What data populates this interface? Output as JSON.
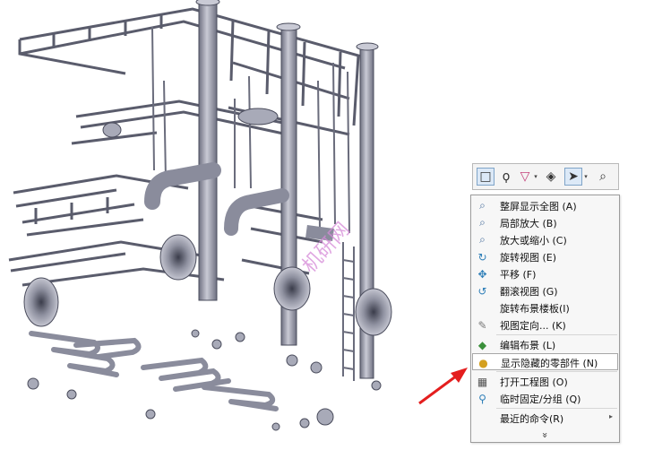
{
  "watermark": "机研网",
  "toolbar": {
    "icons": [
      "selection-box-icon",
      "lasso-icon",
      "filter-icon",
      "view-orientation-icon",
      "select-arrow-icon",
      "zoom-icon"
    ],
    "dropdown_glyph": "▾"
  },
  "context_menu": {
    "items": [
      {
        "label": "整屏显示全图 (A)",
        "icon": "zoom-to-fit-icon"
      },
      {
        "label": "局部放大 (B)",
        "icon": "zoom-to-area-icon"
      },
      {
        "label": "放大或缩小 (C)",
        "icon": "zoom-in-out-icon"
      },
      {
        "label": "旋转视图 (E)",
        "icon": "rotate-view-icon"
      },
      {
        "label": "平移 (F)",
        "icon": "pan-icon"
      },
      {
        "label": "翻滚视图 (G)",
        "icon": "roll-view-icon"
      },
      {
        "label": "旋转布景楼板(I)",
        "icon": ""
      },
      {
        "label": "视图定向... (K)",
        "icon": "view-orientation-icon"
      },
      {
        "label": "编辑布景 (L)",
        "icon": "edit-scene-icon"
      },
      {
        "label": "显示隐藏的零部件 (N)",
        "icon": "show-hidden-components-icon"
      },
      {
        "label": "打开工程图 (O)",
        "icon": "open-drawing-icon"
      },
      {
        "label": "临时固定/分组 (Q)",
        "icon": "temporary-fix-icon"
      },
      {
        "label": "最近的命令(R)",
        "icon": "",
        "submenu_glyph": "▸"
      }
    ],
    "expand_glyph": "»",
    "highlighted_index": 9
  },
  "colors": {
    "model": "#a8aab8",
    "model_edge": "#4a4c5c",
    "arrow": "#e41e1e",
    "watermark": "#d68ad8",
    "menu_bg": "#f7f7f7"
  }
}
